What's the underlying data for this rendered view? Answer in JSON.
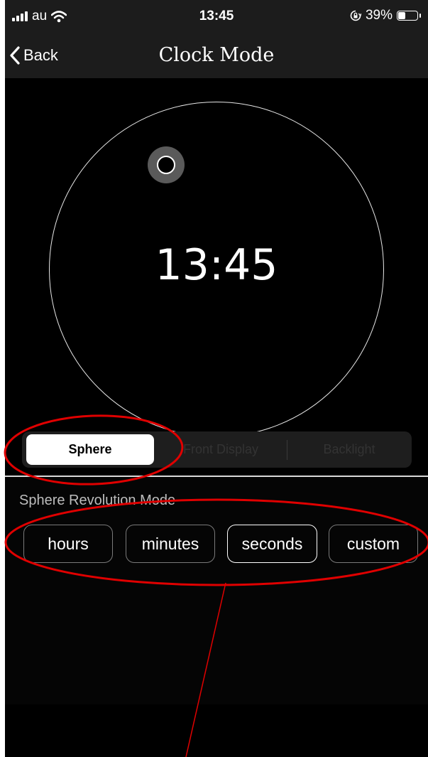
{
  "status_bar": {
    "carrier": "au",
    "time": "13:45",
    "battery": "39%",
    "battery_level": 0.39,
    "icons": [
      "signal-icon",
      "wifi-icon",
      "orientation-lock-icon",
      "battery-icon"
    ]
  },
  "nav": {
    "back_label": "Back",
    "title": "Clock Mode"
  },
  "clock": {
    "time": "13:45"
  },
  "segmented": {
    "items": [
      "Sphere",
      "Front Display",
      "Backlight"
    ],
    "selected": "Sphere"
  },
  "revolution": {
    "label": "Sphere Revolution Mode",
    "options": [
      "hours",
      "minutes",
      "seconds",
      "custom"
    ],
    "selected": "seconds"
  },
  "colors": {
    "background": "#000000",
    "bar_background": "#1c1c1c",
    "annotation": "#e00000",
    "segment_active": "#ffffff"
  }
}
